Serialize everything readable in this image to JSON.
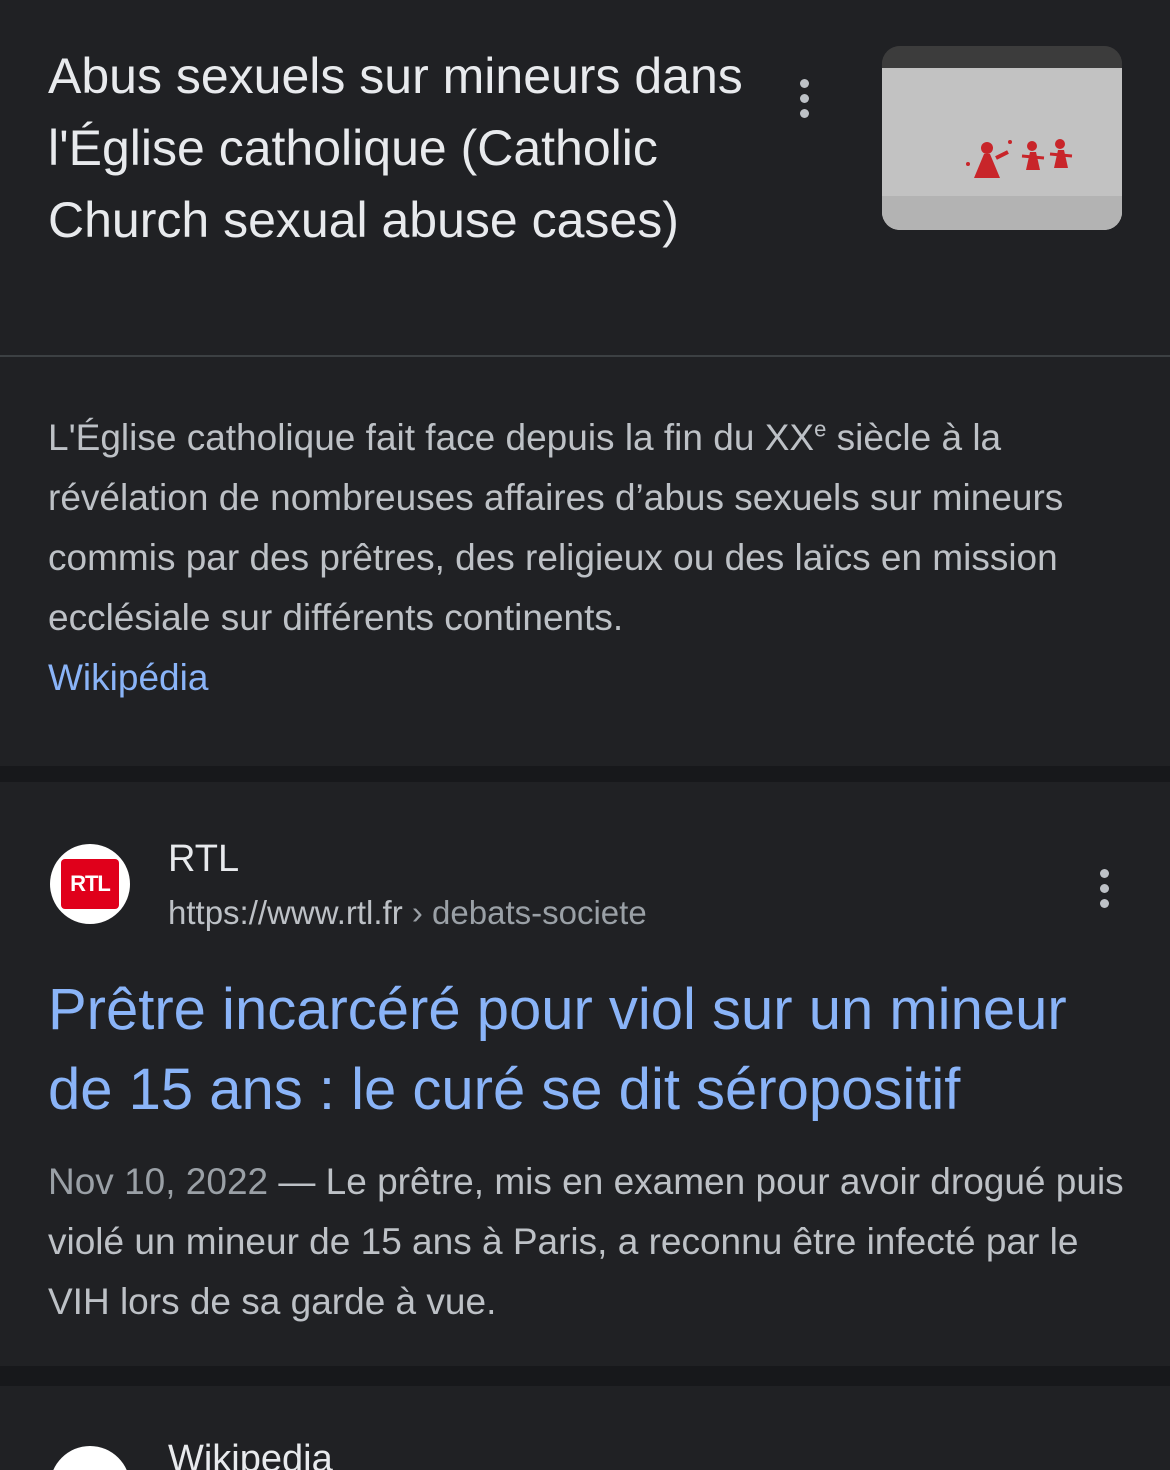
{
  "knowledge_panel": {
    "title": "Abus sexuels sur mineurs dans l'Église catholique (Catholic Church sexual abuse cases)",
    "menu_icon": "more-vert-icon",
    "thumbnail": "graffiti-image",
    "description_before_sup": "L'Église catholique fait face depuis la fin du XX",
    "description_sup": "e",
    "description_after_sup": " siècle à la révélation de nombreuses affaires d’abus sexuels sur mineurs commis par des prêtres, des religieux ou des laïcs en mission ecclésiale sur différents continents.",
    "source": "Wikipédia"
  },
  "result": {
    "favicon_text": "RTL",
    "site_name": "RTL",
    "url_base": "https://www.rtl.fr",
    "url_crumb": " › debats-societe",
    "menu_icon": "more-vert-icon",
    "title": "Prêtre incarcéré pour viol sur un mineur de 15 ans : le curé se dit séropositif",
    "date": "Nov 10, 2022",
    "snippet": " — Le prêtre, mis en examen pour avoir drogué puis violé un mineur de 15 ans à Paris, a reconnu être infecté par le VIH lors de sa garde à vue."
  },
  "next_result": {
    "site_name": "Wikipedia"
  },
  "colors": {
    "background": "#202124",
    "link": "#8ab4f8",
    "text_primary": "#e8eaed",
    "text_secondary": "#bdc1c6"
  }
}
